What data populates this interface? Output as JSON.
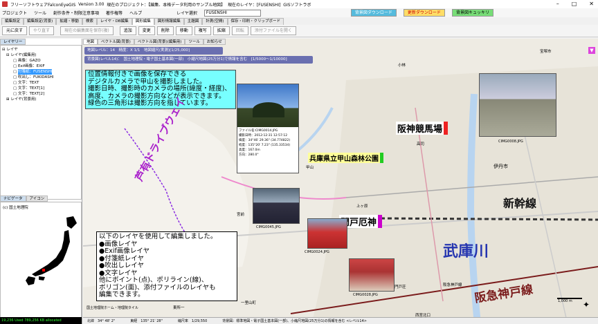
{
  "title": {
    "app": "フリーソフトウェアFalconEyeGIS",
    "version": "Version 3.00",
    "project": "現在のプロジェクト：【編集、本格データ利用のサンプル地図】",
    "current_layer": "現在のレイヤ：[FUSENSHI]",
    "company": "GISソフトラボ"
  },
  "menu": {
    "items": [
      "プロジェクト",
      "ツール",
      "創作条件・制限注意事項",
      "著作権等",
      "ヘルプ"
    ],
    "layer_select_label": "レイヤ選択",
    "layer_select_value": "FUSENSHI",
    "btn_bg_download": "背景図ダウンロード",
    "btn_rakuten": "更新ダウンロード",
    "btn_clear": "背景図キュッキリ"
  },
  "tabs": [
    "編集設定",
    "編集設定(背景)",
    "拡縮・移動",
    "検索",
    "レイヤ・DB編集",
    "図形編集",
    "図形情報編集",
    "主題図",
    "計測(空間)",
    "保存・印刷・クリップボード"
  ],
  "toolbar": [
    "元に戻す",
    "やり直す",
    "現在の編集面を保存(複)",
    "追加",
    "変更",
    "削除",
    "移動",
    "複写",
    "拡縮",
    "回転",
    "添付ファイルを開く"
  ],
  "left": {
    "tabs": [
      "レイヤリー"
    ],
    "tree": [
      "レイヤ",
      "レイヤ(編集用)",
      "画像：GAZO",
      "Exif画像：EXIF",
      "付箋紙：FUSENSHI",
      "吹出し：FUKIDASHI",
      "文字：TEXT",
      "文字：TEXT[1]",
      "文字：TEXT[2]",
      "レイヤ(背景用)"
    ],
    "selected": "付箋紙：FUSENSHI",
    "nav_tabs": [
      "ナビゲータ",
      "アイコン"
    ],
    "nav_title": "(c) 国土地理院",
    "progress": "19,236 Used 789,256 KB allocated"
  },
  "map": {
    "tabs": [
      "地図",
      "ベクトル図(背景)",
      "ベクトル図(背景)(編集用)",
      "ツール",
      "お知らせ"
    ],
    "info1": "地図レベル：14　精度：X 1/1　地図縮尺(実測)[1/25,000]",
    "info2": "背景図(レベル14)：　国土地理院・電子国土基本図(一部)　小縮尺地図(25万分1)で情報を含む　[1/5000～1/10000]",
    "note_exif": "位置情報付きで画像を保存できる\nデジタルカメラで甲山を撮影しました。\n撮影日時、撮影時のカメラの場所(緯度・経度)、\n高度、カメラの撮影方向などが表示できます。\n緑色の三角形は撮影方向を指しています。",
    "note_layers": "以下のレイヤを使用して編集しました。\n●画像レイヤ\n●Exif画像レイヤ\n●付箋紙レイヤ\n●吹出しレイヤ\n●文字レイヤ\n他にポイント(点)、ポリライン(線)、\nポリゴン(面)、添付ファイルのレイヤも\n編集できます。",
    "labels": {
      "hanshin": "阪神競馬場",
      "kabutoyama": "兵庫県立甲山森林公園",
      "momonkyo": "門戸厄神",
      "shinkansen": "新幹線",
      "mukogawa": "武庫川",
      "hankyu": "阪急神戸線",
      "driveway": "芦有ドライブウェイ"
    },
    "exif_caption": [
      "ファイル名:CIMG0014.JPG",
      "撮影日時：2012:12:31 12:57:12",
      "緯度：34°46' 29.36\" (34.774822)",
      "経度：135°20' 7.23\" (135.33534)",
      "高度：167.0m",
      "方向：280.0°"
    ],
    "photos": [
      "CIMG0008.JPG",
      "CIMG0045.JPG",
      "CIMG0024.JPG",
      "CIMG0028.JPG"
    ],
    "places": [
      "伊丹市",
      "高司",
      "小林",
      "宝塚市",
      "甲山",
      "宮前",
      "一里山町",
      "東所一",
      "西宮北口",
      "阪急神戸線",
      "上ヶ原",
      "門戸荘"
    ],
    "copyright": "国土地理院ホーム・地理院タイル",
    "scale": "1,000 m",
    "status": [
      "北緯　34° 48' 2\"",
      "東経　135° 21' 28\"",
      "縮尺率　1/29,550",
      "背景図：標準地図・電子国土基本図(一部)、小縮尺地図(25万分1)の情報を含む <レベル14>"
    ]
  },
  "colors": {
    "cyan": "#77ffff",
    "purple": "#a2c",
    "hankyu": "#7a1b1b",
    "river": "#2535b0"
  }
}
